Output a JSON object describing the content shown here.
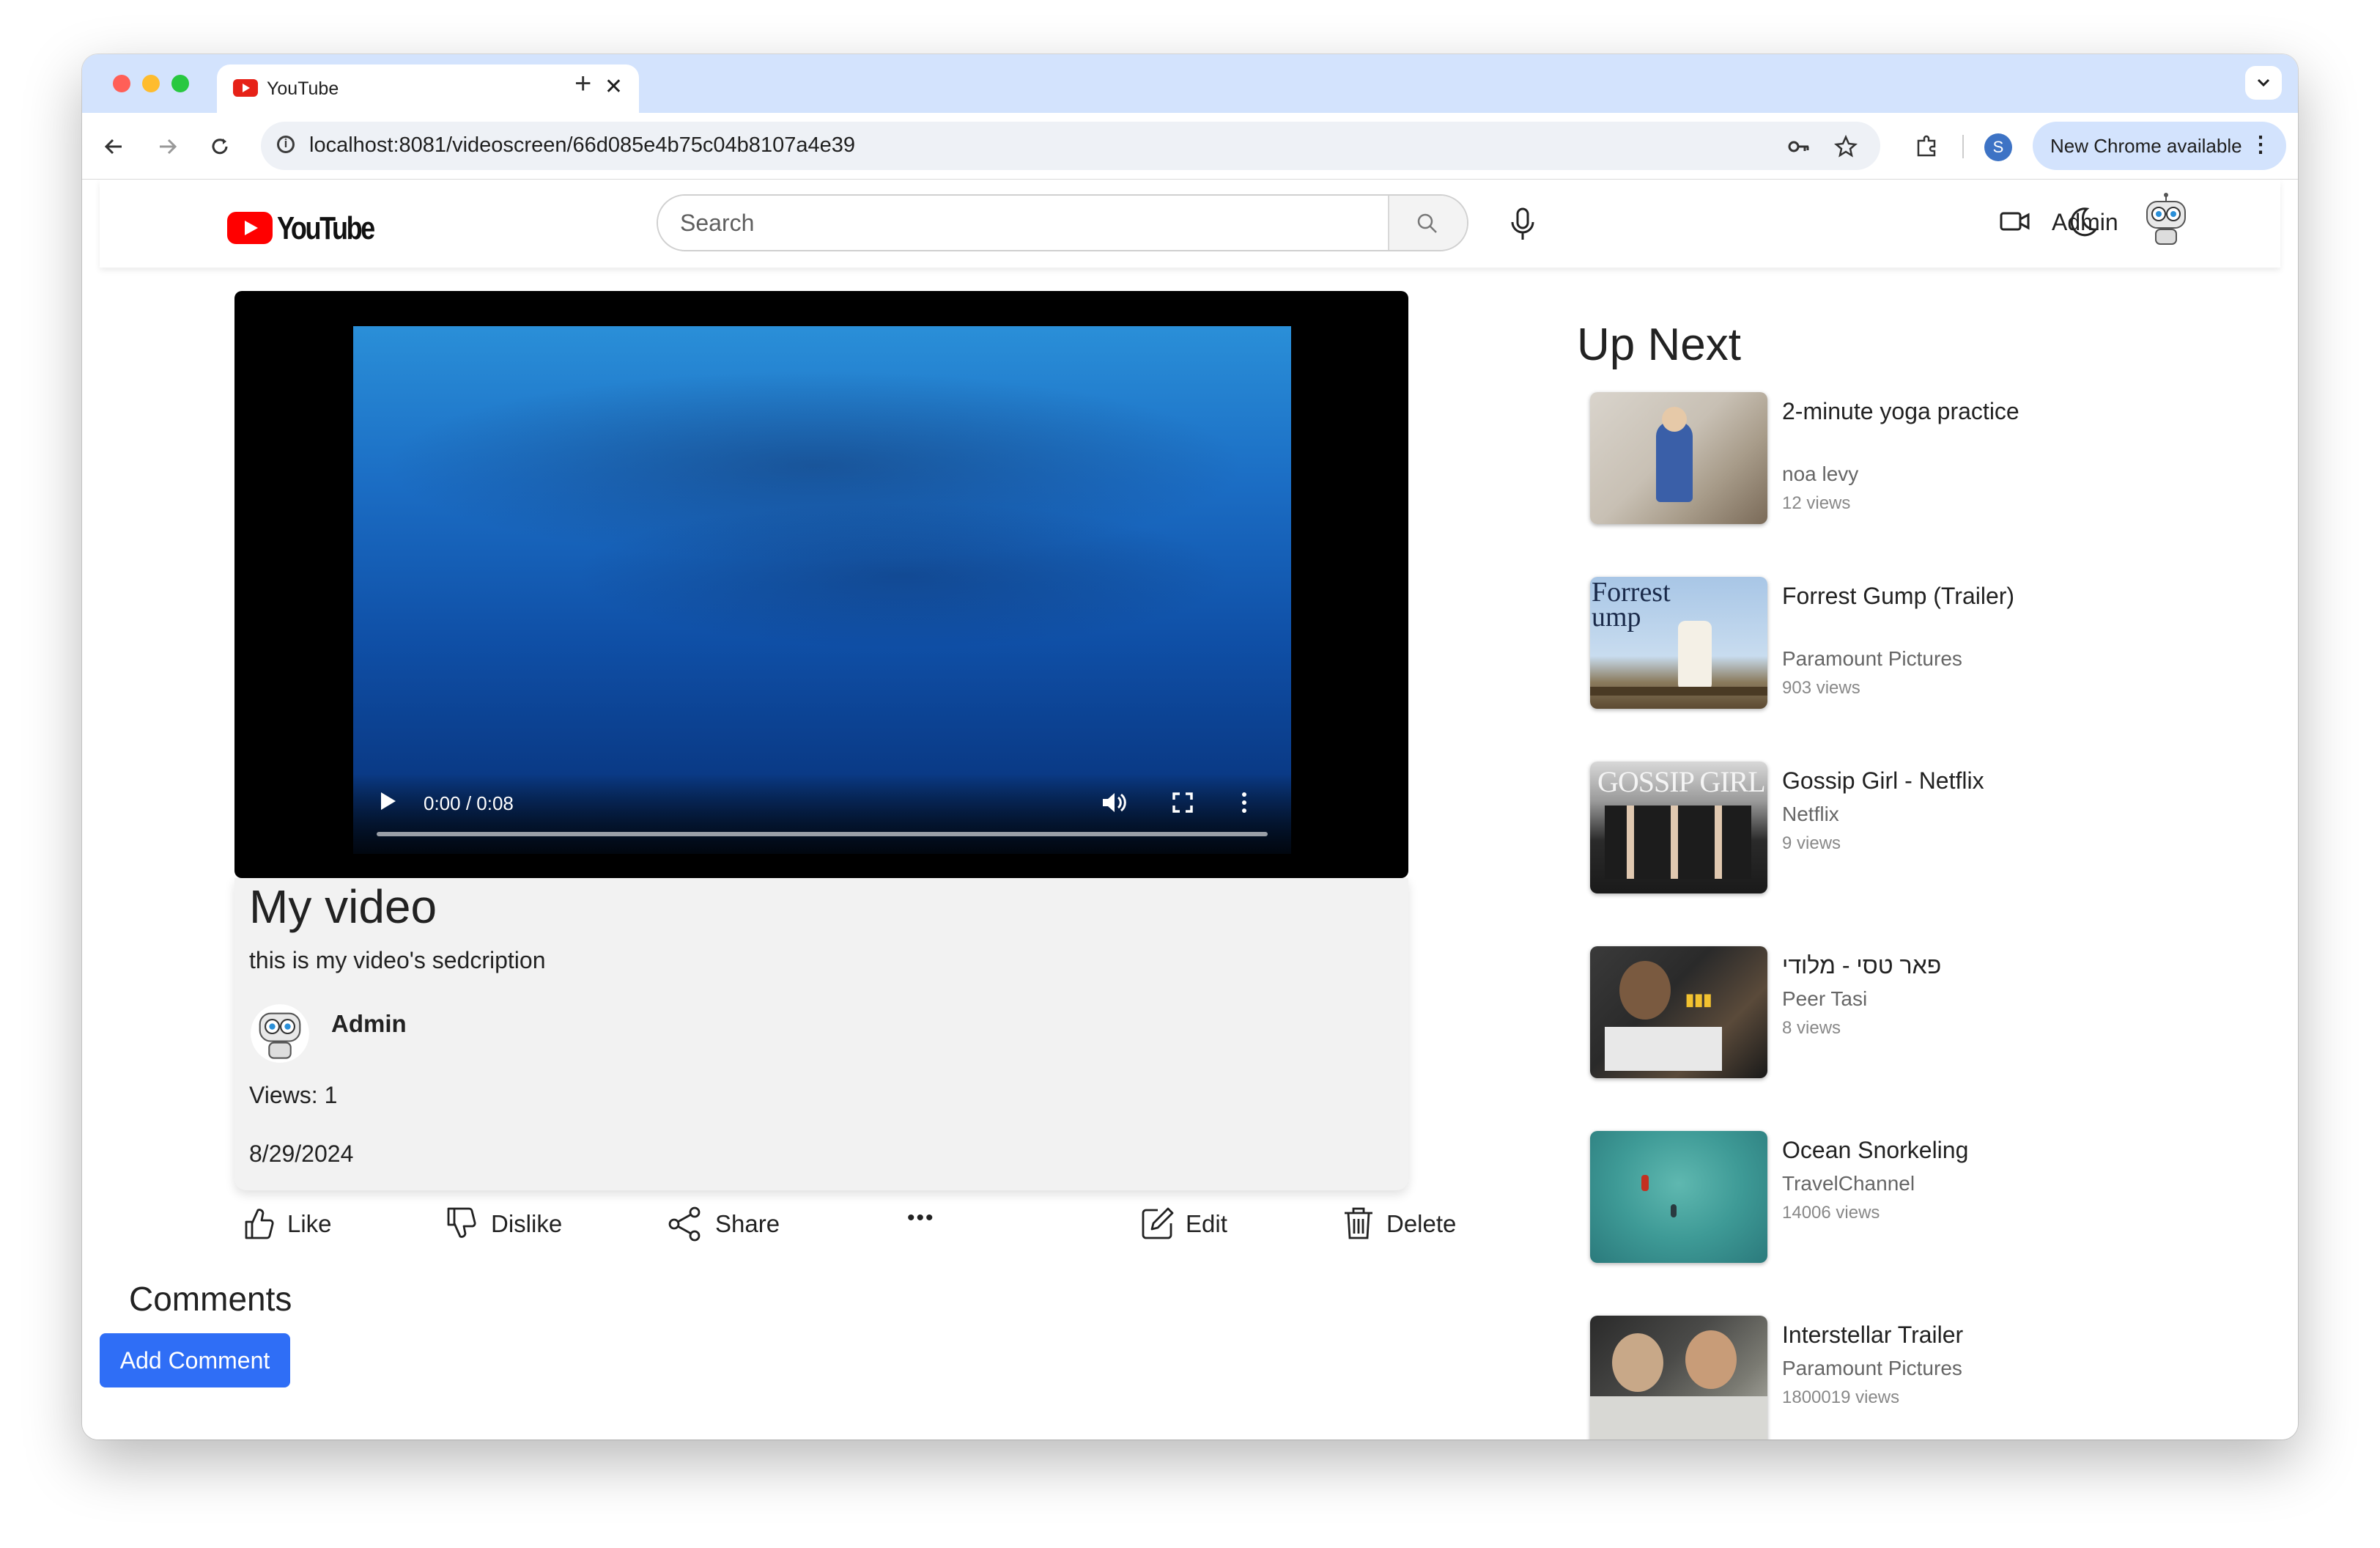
{
  "browser": {
    "tab_title": "YouTube",
    "url": "localhost:8081/videoscreen/66d085e4b75c04b8107a4e39",
    "profile_initial": "S",
    "update_label": "New Chrome available"
  },
  "header": {
    "logo_text": "YouTube",
    "search_placeholder": "Search",
    "username": "Admin"
  },
  "video": {
    "time": "0:00 / 0:08",
    "title": "My video",
    "description": "this is my video's sedcription",
    "owner": "Admin",
    "views": "Views: 1",
    "date": "8/29/2024"
  },
  "actions": {
    "like": "Like",
    "dislike": "Dislike",
    "share": "Share",
    "more": "•••",
    "edit": "Edit",
    "delete": "Delete"
  },
  "comments": {
    "title": "Comments",
    "add_button": "Add Comment"
  },
  "up_next": {
    "title": "Up Next",
    "items": [
      {
        "title": "2-minute yoga practice",
        "channel": "noa levy",
        "views": "12 views"
      },
      {
        "title": "Forrest Gump (Trailer)",
        "channel": "Paramount Pictures",
        "views": "903 views"
      },
      {
        "title": "Gossip Girl - Netflix",
        "channel": "Netflix",
        "views": "9 views"
      },
      {
        "title": "פאר טסי - מלודי",
        "channel": "Peer Tasi",
        "views": "8 views"
      },
      {
        "title": "Ocean Snorkeling",
        "channel": "TravelChannel",
        "views": "14006 views"
      },
      {
        "title": "Interstellar Trailer",
        "channel": "Paramount Pictures",
        "views": "1800019 views"
      }
    ]
  }
}
